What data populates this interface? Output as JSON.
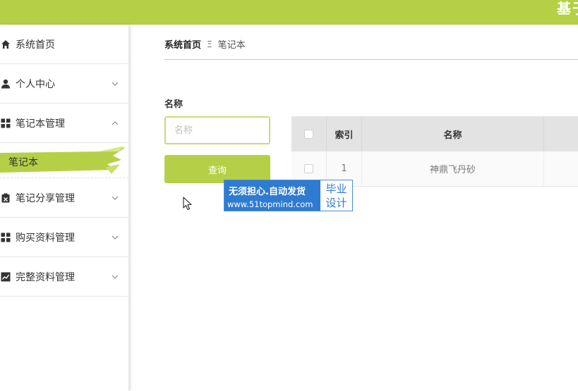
{
  "header": {
    "title": "基于"
  },
  "sidebar": {
    "items": [
      {
        "label": "系统首页",
        "icon": "home-icon"
      },
      {
        "label": "个人中心",
        "icon": "user-icon"
      },
      {
        "label": "笔记本管理",
        "icon": "grid-icon"
      },
      {
        "label": "笔记分享管理",
        "icon": "clipboard-icon"
      },
      {
        "label": "购买资料管理",
        "icon": "grid-icon"
      },
      {
        "label": "完整资料管理",
        "icon": "chart-icon"
      }
    ],
    "submenu_active": "笔记本"
  },
  "breadcrumb": {
    "home": "系统首页",
    "separator": "Ξ",
    "current": "笔记本"
  },
  "search": {
    "label": "名称",
    "placeholder": "名称",
    "button": "查询"
  },
  "table": {
    "headers": {
      "index": "索引",
      "name": "名称"
    },
    "rows": [
      {
        "index": "1",
        "name": "神鼎飞丹砂"
      }
    ]
  },
  "watermark": {
    "line1": "无须担心.自动发货",
    "line2": "www.51topmind.com",
    "tag_top": "毕业",
    "tag_bottom": "设计"
  },
  "colors": {
    "accent": "#b5d046",
    "accent_light": "#c9dc73",
    "watermark_blue": "#2f7bd1"
  }
}
